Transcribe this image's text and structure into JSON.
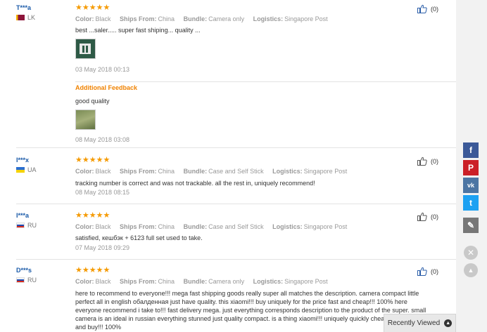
{
  "reviews": [
    {
      "user": "T***a",
      "country": "LK",
      "stars": "★★★★★",
      "color_label": "Color:",
      "color": "Black",
      "ships_label": "Ships From:",
      "ships": "China",
      "bundle_label": "Bundle:",
      "bundle": "Camera only",
      "logistics_label": "Logistics:",
      "logistics": "Singapore Post",
      "text": "best ...saler..... super fast shiping... quality ...",
      "date": "03 May 2018 00:13",
      "likes": "(0)",
      "additional_label": "Additional Feedback",
      "additional_text": "good quality",
      "additional_date": "08 May 2018 03:08"
    },
    {
      "user": "I***x",
      "country": "UA",
      "stars": "★★★★★",
      "color_label": "Color:",
      "color": "Black",
      "ships_label": "Ships From:",
      "ships": "China",
      "bundle_label": "Bundle:",
      "bundle": "Case and Self Stick",
      "logistics_label": "Logistics:",
      "logistics": "Singapore Post",
      "text": "tracking number is correct and was not trackable. all the rest in, uniquely recommend!",
      "date": "08 May 2018 08:15",
      "likes": "(0)"
    },
    {
      "user": "I***a",
      "country": "RU",
      "stars": "★★★★★",
      "color_label": "Color:",
      "color": "Black",
      "ships_label": "Ships From:",
      "ships": "China",
      "bundle_label": "Bundle:",
      "bundle": "Case and Self Stick",
      "logistics_label": "Logistics:",
      "logistics": "Singapore Post",
      "text": "satisfied, кешбэк + 6123 full set used to take.",
      "date": "07 May 2018 09:29",
      "likes": "(0)"
    },
    {
      "user": "D***s",
      "country": "RU",
      "stars": "★★★★★",
      "color_label": "Color:",
      "color": "Black",
      "ships_label": "Ships From:",
      "ships": "China",
      "bundle_label": "Bundle:",
      "bundle": "Camera only",
      "logistics_label": "Logistics:",
      "logistics": "Singapore Post",
      "text_lines": [
        "here to recommend to everyone!!! mega fast shipping goods really super all matches the description. camera compact little",
        "perfect all in english обалденная just have quality. this xiaomi!!! buy uniquely for the price fast and cheap!!! 100% here",
        "everyone recommend i take to!!! fast delivery mega. just everything corresponds description to the product of the super. small",
        "camera is an ideal in russian everything stunned just quality compact. is a thing xiaomi!!! uniquely quickly cheap!",
        "and buy!!! 100%"
      ],
      "likes": "(0)"
    }
  ],
  "share": {
    "facebook": "f",
    "pinterest": "P",
    "vk": "vk",
    "twitter": "t",
    "edit": "✎",
    "close": "✕",
    "up": "▲"
  },
  "recently_viewed": {
    "label": "Recently Viewed",
    "icon": "▲"
  },
  "colors": {
    "star": "#f59a00",
    "user": "#1a5aa8",
    "feedback": "#f08200",
    "facebook": "#3b5998",
    "pinterest": "#cb2027",
    "vk": "#4c75a3",
    "twitter": "#1da1f2"
  }
}
